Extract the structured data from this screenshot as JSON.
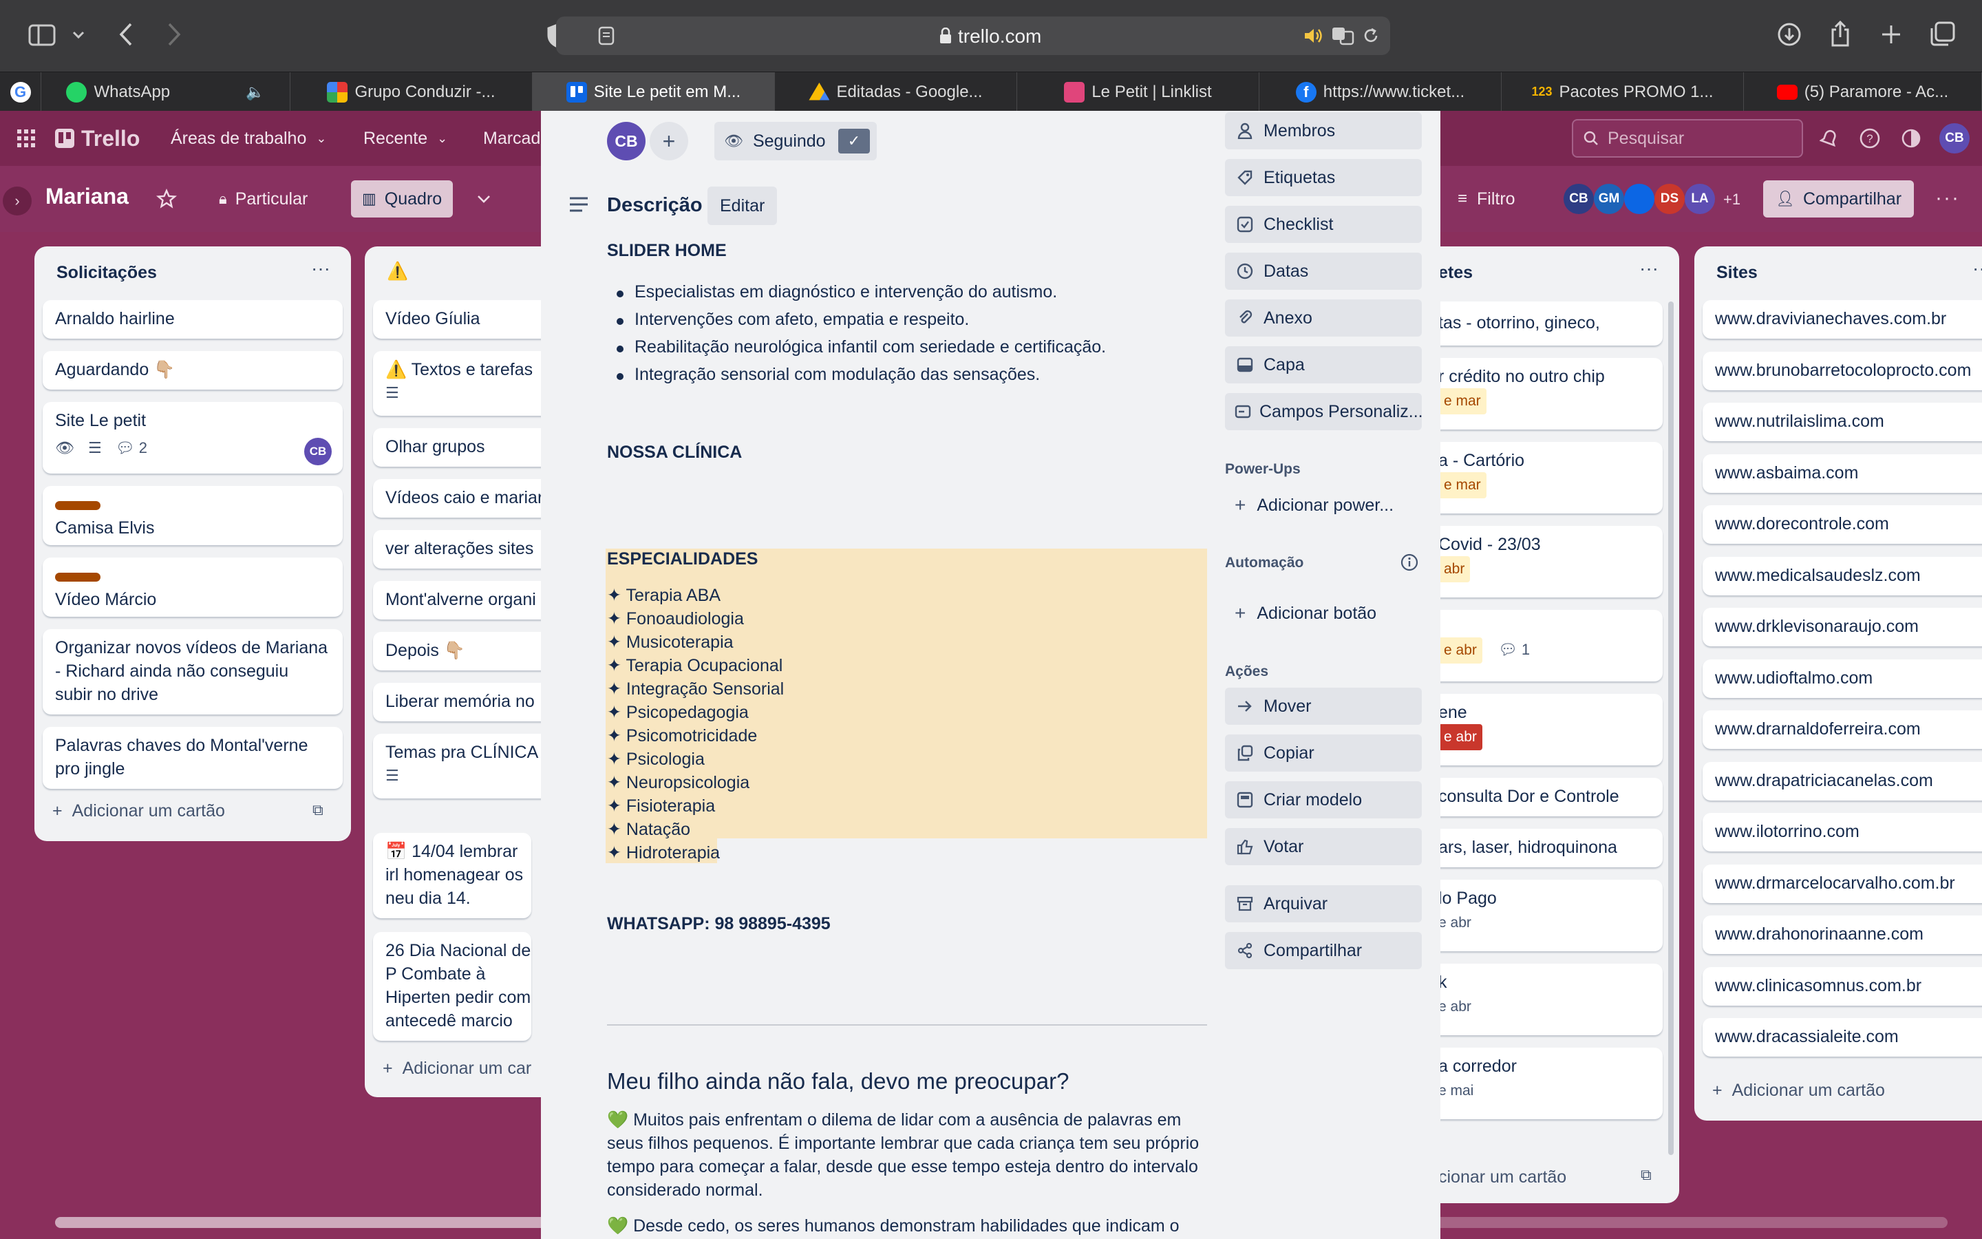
{
  "browser": {
    "url": "trello.com",
    "tabs": [
      {
        "title": "",
        "icon": "google-icon",
        "color": "#4285f4"
      },
      {
        "title": "WhatsApp",
        "icon": "whatsapp-icon",
        "color": "#25d366"
      },
      {
        "title": "Grupo Conduzir -...",
        "icon": "grupo-icon",
        "color": "#e53935"
      },
      {
        "title": "Site Le petit em M...",
        "icon": "trello-icon",
        "color": "#0c66e4"
      },
      {
        "title": "Editadas - Google...",
        "icon": "google-drive-icon",
        "color": "#fbbc04"
      },
      {
        "title": "Le Petit | Linklist",
        "icon": "linklist-icon",
        "color": "#e0457b"
      },
      {
        "title": "https://www.ticket...",
        "icon": "facebook-icon",
        "color": "#1877f2"
      },
      {
        "title": "Pacotes PROMO 1...",
        "icon": "numbers-icon",
        "color": "#f5b400"
      },
      {
        "title": "(5) Paramore - Ac...",
        "icon": "youtube-icon",
        "color": "#ff0000"
      }
    ]
  },
  "trello": {
    "logo": "Trello",
    "nav": [
      "Áreas de trabalho",
      "Recente",
      "Marcad"
    ],
    "search_placeholder": "Pesquisar",
    "user_initials": "CB"
  },
  "board": {
    "title": "Mariana",
    "visibility": "Particular",
    "view": "Quadro",
    "filter": "Filtro",
    "share": "Compartilhar",
    "members": [
      {
        "initials": "CB",
        "color": "#2e3c84"
      },
      {
        "initials": "GM",
        "color": "#1d63b8"
      },
      {
        "initials": "",
        "color": "#0c66e4"
      },
      {
        "initials": "DS",
        "color": "#c9372c"
      },
      {
        "initials": "LA",
        "color": "#5e4db2"
      }
    ],
    "members_more": "+1"
  },
  "lists": {
    "solicitacoes": {
      "title": "Solicitações",
      "cards": {
        "c1": "Arnaldo hairline",
        "c2": "Aguardando 👇🏼",
        "c3": "Site Le petit",
        "c3_comments": "2",
        "c3_member": "CB",
        "c4": "Camisa Elvis",
        "c5": "Vídeo Márcio",
        "c6": "Organizar novos vídeos de Mariana - Richard ainda não conseguiu subir no drive",
        "c7": "Palavras chaves do Montal'verne pro jingle"
      },
      "add": "Adicionar um cartão"
    },
    "warning": {
      "title": "⚠️",
      "cards": {
        "c1": "Vídeo Gíulia",
        "c2": "⚠️ Textos e tarefas",
        "c3": "Olhar grupos",
        "c4": "Vídeos caio e mariar",
        "c5": "ver alterações sites",
        "c6": "Mont'alverne organi",
        "c7": "Depois 👇🏼",
        "c8": "Liberar memória no",
        "c9": "Temas pra CLÍNICA",
        "c10": "📅 14/04 lembrar irl homenagear os neu dia 14.",
        "c11": "26 Dia Nacional de P Combate à Hiperten pedir com antecedê marcio"
      },
      "add": "Adicionar um car"
    },
    "lembretes": {
      "title": "etes",
      "cards": {
        "c1": "tas - otorrino, gineco,",
        "c2": "r crédito no outro chip",
        "c2_date": "e mar",
        "c3": "a - Cartório",
        "c3_date": "e mar",
        "c4": "Covid - 23/03",
        "c4_date": "abr",
        "c5_date": "e abr",
        "c5_comments": "1",
        "c6": "ene",
        "c6_date": "e abr",
        "c7": "consulta Dor e Controle",
        "c8": "ars, laser, hidroquinona",
        "c9": "lo Pago",
        "c9_date": "e abr",
        "c10": "k",
        "c10_date": "e abr",
        "c11": "a corredor",
        "c11_date": "e mai"
      },
      "add": "cionar um cartão"
    },
    "sites": {
      "title": "Sites",
      "cards": [
        "www.dravivianechaves.com.br",
        "www.brunobarretocoloprocto.com",
        "www.nutrilaislima.com",
        "www.asbaima.com",
        "www.dorecontrole.com",
        "www.medicalsaudeslz.com",
        "www.drklevisonaraujo.com",
        "www.udioftalmo.com",
        "www.drarnaldoferreira.com",
        "www.drapatriciacanelas.com",
        "www.ilotorrino.com",
        "www.drmarcelocarvalho.com.br",
        "www.drahonorinaanne.com",
        "www.clinicasomnus.com.br",
        "www.dracassialeite.com"
      ],
      "add": "Adicionar um cartão"
    }
  },
  "modal": {
    "member_initials": "CB",
    "following": "Seguindo",
    "description_title": "Descrição",
    "edit": "Editar",
    "slider_title": "SLIDER HOME",
    "slider_items": [
      "Especialistas em diagnóstico e intervenção do autismo.",
      "Intervenções com afeto, empatia e respeito.",
      "Reabilitação neurológica infantil com seriedade e certificação.",
      "Integração sensorial com modulação das sensações."
    ],
    "clinic_title": "NOSSA CLÍNICA",
    "specialties_title": "ESPECIALIDADES",
    "specialties": [
      "✦ Terapia ABA",
      "✦ Fonoaudiologia",
      "✦ Musicoterapia",
      "✦ Terapia Ocupacional",
      "✦ Integração Sensorial",
      "✦ Psicopedagogia",
      "✦ Psicomotricidade",
      "✦ Psicologia",
      "✦ Neuropsicologia",
      "✦ Fisioterapia",
      "✦ Natação",
      "✦ Hidroterapia"
    ],
    "whatsapp": "WHATSAPP: 98 98895-4395",
    "article_title": "Meu filho ainda não fala, devo me preocupar?",
    "paragraph1": "💚 Muitos pais enfrentam o dilema de lidar com a ausência de palavras em seus filhos pequenos. É importante lembrar que cada criança tem seu próprio tempo para começar a falar, desde que esse tempo esteja dentro do intervalo considerado normal.",
    "paragraph2": "💚 Desde cedo, os seres humanos demonstram habilidades que indicam o",
    "sidebar": {
      "add_items": {
        "membros": "Membros",
        "etiquetas": "Etiquetas",
        "checklist": "Checklist",
        "datas": "Datas",
        "anexo": "Anexo",
        "capa": "Capa",
        "campos": "Campos Personaliz..."
      },
      "powerups_label": "Power-Ups",
      "add_powerup": "Adicionar power...",
      "automation_label": "Automação",
      "add_button": "Adicionar botão",
      "actions_label": "Ações",
      "actions": {
        "mover": "Mover",
        "copiar": "Copiar",
        "criar_modelo": "Criar modelo",
        "votar": "Votar",
        "arquivar": "Arquivar",
        "compartilhar": "Compartilhar"
      }
    }
  },
  "colors": {
    "board_bg": "#8a2f5c",
    "highlight": "#f8e6c1",
    "list_bg": "#f1f2f4",
    "whatsapp_green": "#1f845a"
  }
}
